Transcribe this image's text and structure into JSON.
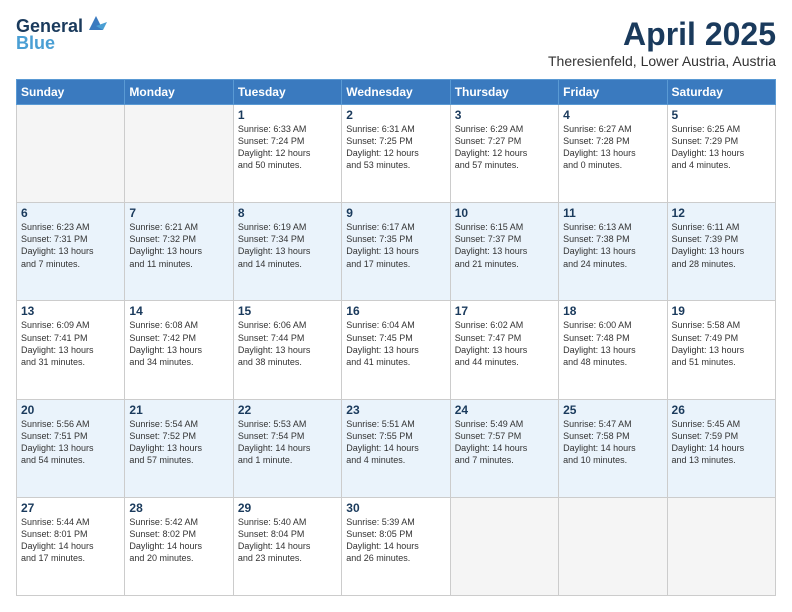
{
  "header": {
    "logo_line1": "General",
    "logo_line2": "Blue",
    "title": "April 2025",
    "subtitle": "Theresienfeld, Lower Austria, Austria"
  },
  "days_of_week": [
    "Sunday",
    "Monday",
    "Tuesday",
    "Wednesday",
    "Thursday",
    "Friday",
    "Saturday"
  ],
  "weeks": [
    {
      "alt": false,
      "days": [
        {
          "num": "",
          "empty": true,
          "lines": []
        },
        {
          "num": "",
          "empty": true,
          "lines": []
        },
        {
          "num": "1",
          "empty": false,
          "lines": [
            "Sunrise: 6:33 AM",
            "Sunset: 7:24 PM",
            "Daylight: 12 hours",
            "and 50 minutes."
          ]
        },
        {
          "num": "2",
          "empty": false,
          "lines": [
            "Sunrise: 6:31 AM",
            "Sunset: 7:25 PM",
            "Daylight: 12 hours",
            "and 53 minutes."
          ]
        },
        {
          "num": "3",
          "empty": false,
          "lines": [
            "Sunrise: 6:29 AM",
            "Sunset: 7:27 PM",
            "Daylight: 12 hours",
            "and 57 minutes."
          ]
        },
        {
          "num": "4",
          "empty": false,
          "lines": [
            "Sunrise: 6:27 AM",
            "Sunset: 7:28 PM",
            "Daylight: 13 hours",
            "and 0 minutes."
          ]
        },
        {
          "num": "5",
          "empty": false,
          "lines": [
            "Sunrise: 6:25 AM",
            "Sunset: 7:29 PM",
            "Daylight: 13 hours",
            "and 4 minutes."
          ]
        }
      ]
    },
    {
      "alt": true,
      "days": [
        {
          "num": "6",
          "empty": false,
          "lines": [
            "Sunrise: 6:23 AM",
            "Sunset: 7:31 PM",
            "Daylight: 13 hours",
            "and 7 minutes."
          ]
        },
        {
          "num": "7",
          "empty": false,
          "lines": [
            "Sunrise: 6:21 AM",
            "Sunset: 7:32 PM",
            "Daylight: 13 hours",
            "and 11 minutes."
          ]
        },
        {
          "num": "8",
          "empty": false,
          "lines": [
            "Sunrise: 6:19 AM",
            "Sunset: 7:34 PM",
            "Daylight: 13 hours",
            "and 14 minutes."
          ]
        },
        {
          "num": "9",
          "empty": false,
          "lines": [
            "Sunrise: 6:17 AM",
            "Sunset: 7:35 PM",
            "Daylight: 13 hours",
            "and 17 minutes."
          ]
        },
        {
          "num": "10",
          "empty": false,
          "lines": [
            "Sunrise: 6:15 AM",
            "Sunset: 7:37 PM",
            "Daylight: 13 hours",
            "and 21 minutes."
          ]
        },
        {
          "num": "11",
          "empty": false,
          "lines": [
            "Sunrise: 6:13 AM",
            "Sunset: 7:38 PM",
            "Daylight: 13 hours",
            "and 24 minutes."
          ]
        },
        {
          "num": "12",
          "empty": false,
          "lines": [
            "Sunrise: 6:11 AM",
            "Sunset: 7:39 PM",
            "Daylight: 13 hours",
            "and 28 minutes."
          ]
        }
      ]
    },
    {
      "alt": false,
      "days": [
        {
          "num": "13",
          "empty": false,
          "lines": [
            "Sunrise: 6:09 AM",
            "Sunset: 7:41 PM",
            "Daylight: 13 hours",
            "and 31 minutes."
          ]
        },
        {
          "num": "14",
          "empty": false,
          "lines": [
            "Sunrise: 6:08 AM",
            "Sunset: 7:42 PM",
            "Daylight: 13 hours",
            "and 34 minutes."
          ]
        },
        {
          "num": "15",
          "empty": false,
          "lines": [
            "Sunrise: 6:06 AM",
            "Sunset: 7:44 PM",
            "Daylight: 13 hours",
            "and 38 minutes."
          ]
        },
        {
          "num": "16",
          "empty": false,
          "lines": [
            "Sunrise: 6:04 AM",
            "Sunset: 7:45 PM",
            "Daylight: 13 hours",
            "and 41 minutes."
          ]
        },
        {
          "num": "17",
          "empty": false,
          "lines": [
            "Sunrise: 6:02 AM",
            "Sunset: 7:47 PM",
            "Daylight: 13 hours",
            "and 44 minutes."
          ]
        },
        {
          "num": "18",
          "empty": false,
          "lines": [
            "Sunrise: 6:00 AM",
            "Sunset: 7:48 PM",
            "Daylight: 13 hours",
            "and 48 minutes."
          ]
        },
        {
          "num": "19",
          "empty": false,
          "lines": [
            "Sunrise: 5:58 AM",
            "Sunset: 7:49 PM",
            "Daylight: 13 hours",
            "and 51 minutes."
          ]
        }
      ]
    },
    {
      "alt": true,
      "days": [
        {
          "num": "20",
          "empty": false,
          "lines": [
            "Sunrise: 5:56 AM",
            "Sunset: 7:51 PM",
            "Daylight: 13 hours",
            "and 54 minutes."
          ]
        },
        {
          "num": "21",
          "empty": false,
          "lines": [
            "Sunrise: 5:54 AM",
            "Sunset: 7:52 PM",
            "Daylight: 13 hours",
            "and 57 minutes."
          ]
        },
        {
          "num": "22",
          "empty": false,
          "lines": [
            "Sunrise: 5:53 AM",
            "Sunset: 7:54 PM",
            "Daylight: 14 hours",
            "and 1 minute."
          ]
        },
        {
          "num": "23",
          "empty": false,
          "lines": [
            "Sunrise: 5:51 AM",
            "Sunset: 7:55 PM",
            "Daylight: 14 hours",
            "and 4 minutes."
          ]
        },
        {
          "num": "24",
          "empty": false,
          "lines": [
            "Sunrise: 5:49 AM",
            "Sunset: 7:57 PM",
            "Daylight: 14 hours",
            "and 7 minutes."
          ]
        },
        {
          "num": "25",
          "empty": false,
          "lines": [
            "Sunrise: 5:47 AM",
            "Sunset: 7:58 PM",
            "Daylight: 14 hours",
            "and 10 minutes."
          ]
        },
        {
          "num": "26",
          "empty": false,
          "lines": [
            "Sunrise: 5:45 AM",
            "Sunset: 7:59 PM",
            "Daylight: 14 hours",
            "and 13 minutes."
          ]
        }
      ]
    },
    {
      "alt": false,
      "days": [
        {
          "num": "27",
          "empty": false,
          "lines": [
            "Sunrise: 5:44 AM",
            "Sunset: 8:01 PM",
            "Daylight: 14 hours",
            "and 17 minutes."
          ]
        },
        {
          "num": "28",
          "empty": false,
          "lines": [
            "Sunrise: 5:42 AM",
            "Sunset: 8:02 PM",
            "Daylight: 14 hours",
            "and 20 minutes."
          ]
        },
        {
          "num": "29",
          "empty": false,
          "lines": [
            "Sunrise: 5:40 AM",
            "Sunset: 8:04 PM",
            "Daylight: 14 hours",
            "and 23 minutes."
          ]
        },
        {
          "num": "30",
          "empty": false,
          "lines": [
            "Sunrise: 5:39 AM",
            "Sunset: 8:05 PM",
            "Daylight: 14 hours",
            "and 26 minutes."
          ]
        },
        {
          "num": "",
          "empty": true,
          "lines": []
        },
        {
          "num": "",
          "empty": true,
          "lines": []
        },
        {
          "num": "",
          "empty": true,
          "lines": []
        }
      ]
    }
  ]
}
